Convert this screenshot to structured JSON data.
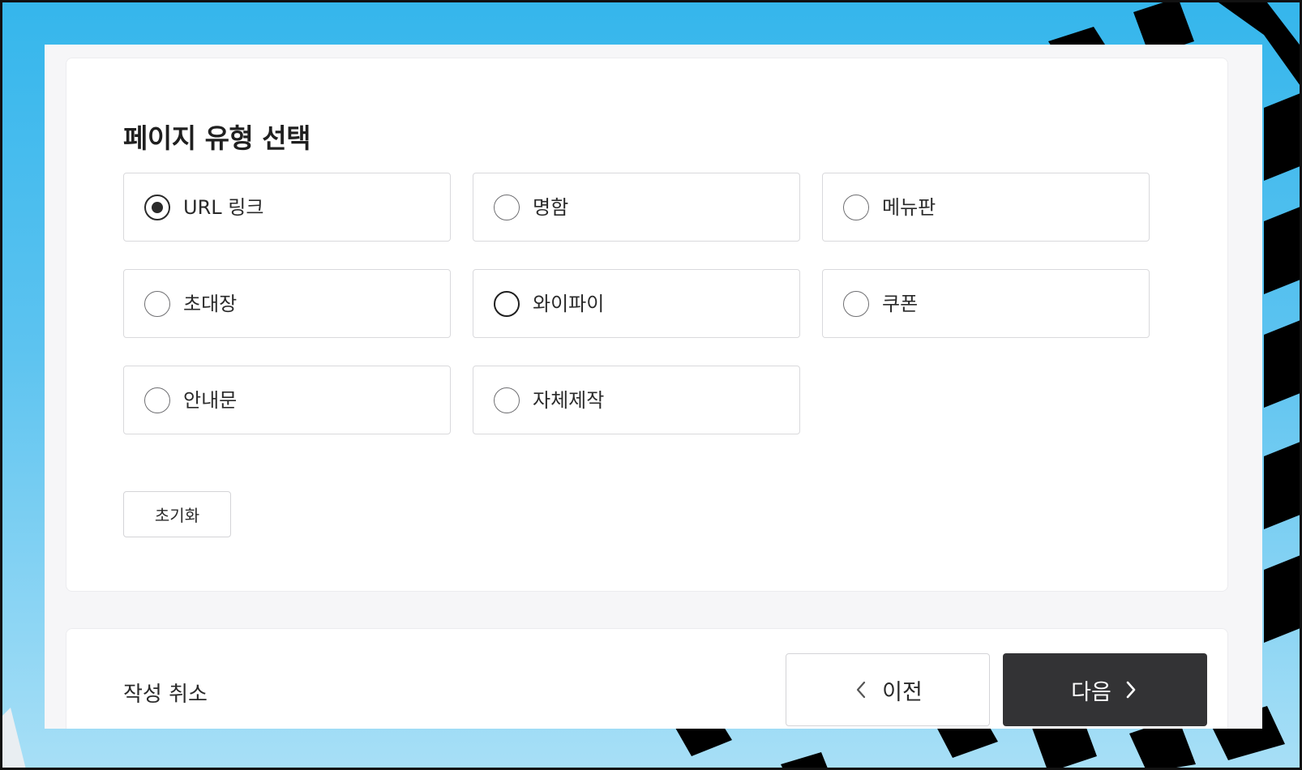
{
  "page": {
    "title": "페이지 유형 선택"
  },
  "page_types": {
    "options": [
      {
        "label": "URL 링크",
        "selected": true
      },
      {
        "label": "명함",
        "selected": false
      },
      {
        "label": "메뉴판",
        "selected": false
      },
      {
        "label": "초대장",
        "selected": false
      },
      {
        "label": "와이파이",
        "selected": false
      },
      {
        "label": "쿠폰",
        "selected": false
      },
      {
        "label": "안내문",
        "selected": false
      },
      {
        "label": "자체제작",
        "selected": false
      }
    ],
    "reset_label": "초기화"
  },
  "footer": {
    "cancel_label": "작성 취소",
    "prev_label": "이전",
    "next_label": "다음"
  },
  "icons": {
    "prev": "chevron-left-icon",
    "next": "chevron-right-icon"
  },
  "colors": {
    "background_blue": "#35b6ec",
    "primary_button": "#333335",
    "text": "#2a2a2a"
  }
}
